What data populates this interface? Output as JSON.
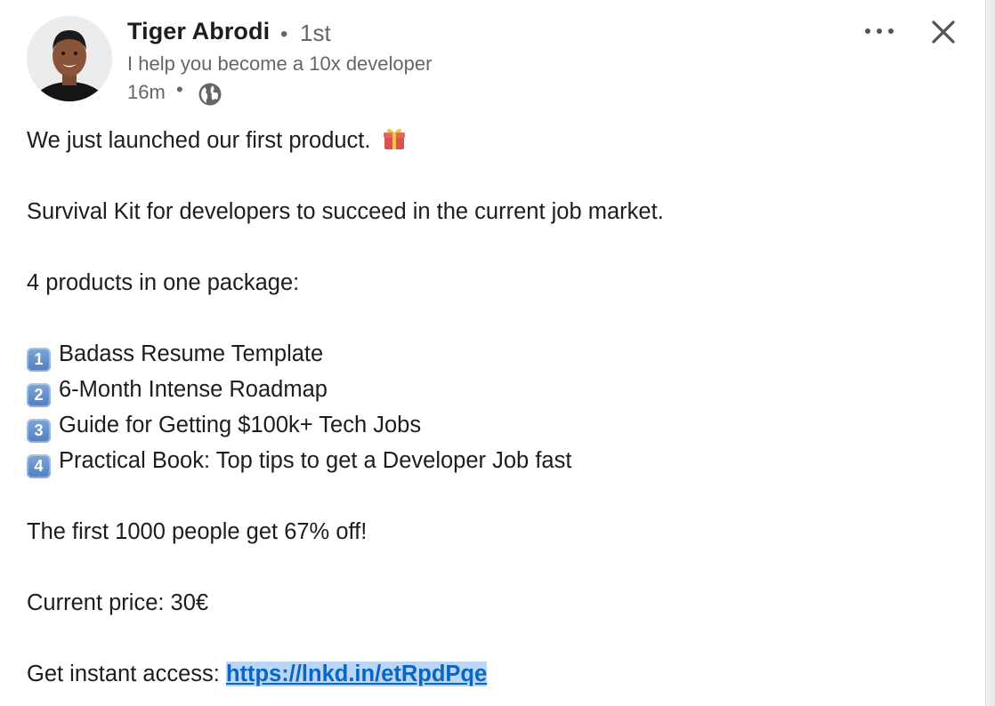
{
  "post": {
    "author": {
      "name": "Tiger Abrodi",
      "separator": "•",
      "degree": "1st",
      "headline": "I help you become a 10x developer",
      "time": "16m",
      "time_separator": "•",
      "avatar_icon": "avatar-photo",
      "visibility_icon": "globe-icon"
    },
    "actions": {
      "more_icon": "more-horizontal-icon",
      "close_icon": "close-icon"
    },
    "body": {
      "line1": "We just launched our first product.",
      "line1_emoji": "gift-emoji",
      "line2": "Survival Kit for developers to succeed in the current job market.",
      "line3": "4 products in one package:",
      "items": [
        {
          "number": "1",
          "text": "Badass Resume Template"
        },
        {
          "number": "2",
          "text": "6-Month Intense Roadmap"
        },
        {
          "number": "3",
          "text": "Guide for Getting $100k+ Tech Jobs"
        },
        {
          "number": "4",
          "text": "Practical Book: Top tips to get a Developer Job fast"
        }
      ],
      "offer": "The first 1000 people get 67% off!",
      "price": "Current price: 30€",
      "access_label": "Get instant access: ",
      "access_link": "https://lnkd.in/etRpdPqe"
    },
    "colors": {
      "link": "#0a66c2",
      "link_highlight": "#b9d6f5",
      "secondary_text": "#666666",
      "primary_text": "#1d1d1d"
    }
  }
}
